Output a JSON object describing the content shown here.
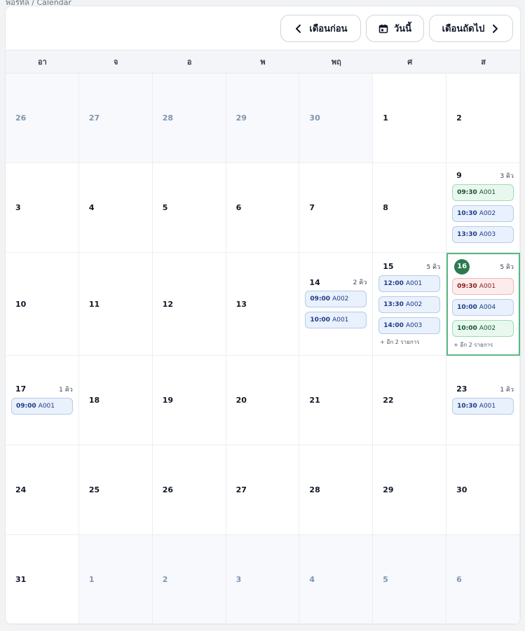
{
  "breadcrumb": "พอร์ทัล / Calendar",
  "toolbar": {
    "prev_label": "เดือนก่อน",
    "today_label": "วันนี้",
    "next_label": "เดือนถัดไป"
  },
  "weekdays": [
    "อา",
    "จ",
    "อ",
    "พ",
    "พฤ",
    "ศ",
    "ส"
  ],
  "colors": {
    "blue_pill": "#e9f1fc",
    "green_pill": "#e9f8ee",
    "red_pill": "#fdecec",
    "today_outline": "#59b97f",
    "today_badge": "#2d7a4f"
  },
  "cells": [
    {
      "day": "26",
      "other": true
    },
    {
      "day": "27",
      "other": true
    },
    {
      "day": "28",
      "other": true
    },
    {
      "day": "29",
      "other": true
    },
    {
      "day": "30",
      "other": true
    },
    {
      "day": "1"
    },
    {
      "day": "2"
    },
    {
      "day": "3"
    },
    {
      "day": "4"
    },
    {
      "day": "5"
    },
    {
      "day": "6"
    },
    {
      "day": "7"
    },
    {
      "day": "8"
    },
    {
      "day": "9",
      "count": "3 คิว",
      "events": [
        {
          "time": "09:30",
          "code": "A001",
          "color": "green"
        },
        {
          "time": "10:30",
          "code": "A002",
          "color": "blue"
        },
        {
          "time": "13:30",
          "code": "A003",
          "color": "blue"
        }
      ]
    },
    {
      "day": "10"
    },
    {
      "day": "11"
    },
    {
      "day": "12"
    },
    {
      "day": "13"
    },
    {
      "day": "14",
      "count": "2 คิว",
      "events": [
        {
          "time": "09:00",
          "code": "A002",
          "color": "blue"
        },
        {
          "time": "10:00",
          "code": "A001",
          "color": "blue"
        }
      ]
    },
    {
      "day": "15",
      "count": "5 คิว",
      "events": [
        {
          "time": "12:00",
          "code": "A001",
          "color": "blue"
        },
        {
          "time": "13:30",
          "code": "A002",
          "color": "blue"
        },
        {
          "time": "14:00",
          "code": "A003",
          "color": "blue"
        }
      ],
      "more": "+ อีก 2 รายการ"
    },
    {
      "day": "16",
      "today": true,
      "count": "5 คิว",
      "events": [
        {
          "time": "09:30",
          "code": "A001",
          "color": "red"
        },
        {
          "time": "10:00",
          "code": "A004",
          "color": "blue"
        },
        {
          "time": "10:00",
          "code": "A002",
          "color": "green"
        }
      ],
      "more": "+ อีก 2 รายการ"
    },
    {
      "day": "17",
      "count": "1 คิว",
      "events": [
        {
          "time": "09:00",
          "code": "A001",
          "color": "blue"
        }
      ]
    },
    {
      "day": "18"
    },
    {
      "day": "19"
    },
    {
      "day": "20"
    },
    {
      "day": "21"
    },
    {
      "day": "22"
    },
    {
      "day": "23",
      "count": "1 คิว",
      "events": [
        {
          "time": "10:30",
          "code": "A001",
          "color": "blue"
        }
      ]
    },
    {
      "day": "24"
    },
    {
      "day": "25"
    },
    {
      "day": "26"
    },
    {
      "day": "27"
    },
    {
      "day": "28"
    },
    {
      "day": "29"
    },
    {
      "day": "30"
    },
    {
      "day": "31"
    },
    {
      "day": "1",
      "other": true
    },
    {
      "day": "2",
      "other": true
    },
    {
      "day": "3",
      "other": true
    },
    {
      "day": "4",
      "other": true
    },
    {
      "day": "5",
      "other": true
    },
    {
      "day": "6",
      "other": true
    }
  ]
}
